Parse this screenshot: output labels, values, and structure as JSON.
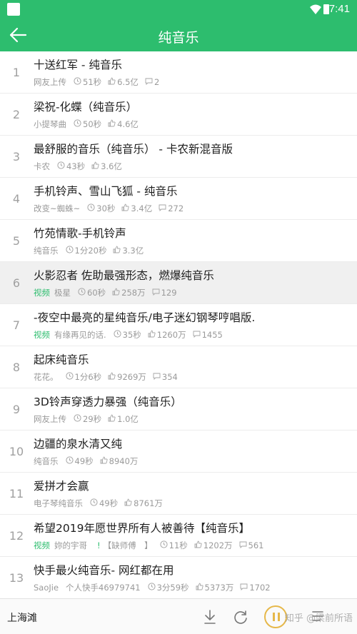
{
  "status_bar": {
    "time": "7:41"
  },
  "app_bar": {
    "title": "纯音乐",
    "back_icon": "arrow-left-icon"
  },
  "colors": {
    "brand_green": "#2dbd6e",
    "play_ring": "#e6b84a",
    "highlight_row": "#f0f0f0"
  },
  "songs": [
    {
      "num": "1",
      "title": "十送红军 - 纯音乐",
      "tag": "",
      "source": "网友上传",
      "duration": "51秒",
      "likes": "6.5亿",
      "comments": "2",
      "highlight": false
    },
    {
      "num": "2",
      "title": "梁祝-化蝶（纯音乐）",
      "tag": "",
      "source": "小提琴曲",
      "duration": "50秒",
      "likes": "4.6亿",
      "comments": "",
      "highlight": false
    },
    {
      "num": "3",
      "title": "最舒服的音乐（纯音乐） - 卡农新混音版",
      "tag": "",
      "source": "卡农",
      "duration": "43秒",
      "likes": "3.6亿",
      "comments": "",
      "highlight": false
    },
    {
      "num": "4",
      "title": "手机铃声、雪山飞狐 - 纯音乐",
      "tag": "",
      "source": "改变~蜘蛛~",
      "duration": "30秒",
      "likes": "3.4亿",
      "comments": "272",
      "highlight": false
    },
    {
      "num": "5",
      "title": "竹苑情歌-手机铃声",
      "tag": "",
      "source": "纯音乐",
      "duration": "1分20秒",
      "likes": "3.3亿",
      "comments": "",
      "highlight": false
    },
    {
      "num": "6",
      "title": "火影忍者 佐助最强形态，燃爆纯音乐",
      "tag": "视频",
      "source": "极星",
      "duration": "60秒",
      "likes": "258万",
      "comments": "129",
      "highlight": true
    },
    {
      "num": "7",
      "title": "-夜空中最亮的星纯音乐/电子迷幻钢琴哼唱版.",
      "tag": "视频",
      "source": "有缘再见的话.",
      "duration": "35秒",
      "likes": "1260万",
      "comments": "1455",
      "highlight": false
    },
    {
      "num": "8",
      "title": "起床纯音乐",
      "tag": "",
      "source": "花花。",
      "duration": "1分6秒",
      "likes": "9269万",
      "comments": "354",
      "highlight": false
    },
    {
      "num": "9",
      "title": "3D铃声穿透力暴强（纯音乐）",
      "tag": "",
      "source": "网友上传",
      "duration": "29秒",
      "likes": "1.0亿",
      "comments": "",
      "highlight": false
    },
    {
      "num": "10",
      "title": "边疆的泉水清又纯",
      "tag": "",
      "source": "纯音乐",
      "duration": "49秒",
      "likes": "8940万",
      "comments": "",
      "highlight": false
    },
    {
      "num": "11",
      "title": "爱拼才会赢",
      "tag": "",
      "source": "电子琴纯音乐",
      "duration": "49秒",
      "likes": "8761万",
      "comments": "",
      "highlight": false
    },
    {
      "num": "12",
      "title": "希望2019年愿世界所有人被善待【纯音乐】",
      "tag": "视频",
      "source": "妳的宇哥",
      "source_extra": "【缺师傅　】",
      "duration": "11秒",
      "likes": "1202万",
      "comments": "561",
      "highlight": false
    },
    {
      "num": "13",
      "title": "快手最火纯音乐- 网红都在用",
      "tag": "",
      "source": "SaoJie",
      "source_extra": "个人快手46979741",
      "duration": "3分59秒",
      "likes": "5373万",
      "comments": "1702",
      "highlight": false
    }
  ],
  "player": {
    "now_playing": "上海滩",
    "watermark": "知乎 @梁前所语"
  }
}
